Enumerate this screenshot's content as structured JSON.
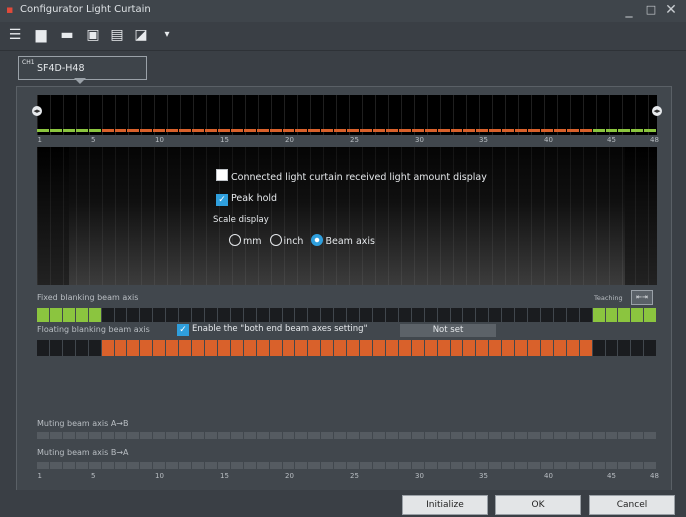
{
  "window": {
    "title": "Configurator Light Curtain",
    "minimize": "_",
    "maximize": "□",
    "close": "✕"
  },
  "toolbar": {
    "icons": [
      "menu-icon",
      "new-file-icon",
      "open-folder-icon",
      "save-icon",
      "save-as-icon",
      "monitor-icon",
      "dropdown-icon"
    ]
  },
  "channel": {
    "ch_label": "CH1",
    "model": "SF4D-H48"
  },
  "scale": {
    "ticks": [
      "1",
      "5",
      "10",
      "15",
      "20",
      "25",
      "30",
      "35",
      "40",
      "45",
      "48"
    ]
  },
  "options": {
    "received_light": "Connected light curtain received light amount display",
    "peak_hold": "Peak hold",
    "scale_display": "Scale display",
    "unit_mm": "mm",
    "unit_inch": "inch",
    "unit_beam_axis": "Beam axis"
  },
  "fixed_blanking": {
    "label": "Fixed blanking beam axis",
    "teaching_label": "Teaching"
  },
  "floating_blanking": {
    "label": "Floating blanking beam axis",
    "enable_label": "Enable the \"both end beam axes setting\"",
    "status": "Not set"
  },
  "muting": {
    "a_to_b": "Muting beam axis A→B",
    "b_to_a": "Muting beam axis B→A"
  },
  "buttons": {
    "initialize": "Initialize",
    "ok": "OK",
    "cancel": "Cancel"
  },
  "colors": {
    "green": "#8bc53f",
    "orange": "#d9612b",
    "accent": "#2f9fdd"
  }
}
